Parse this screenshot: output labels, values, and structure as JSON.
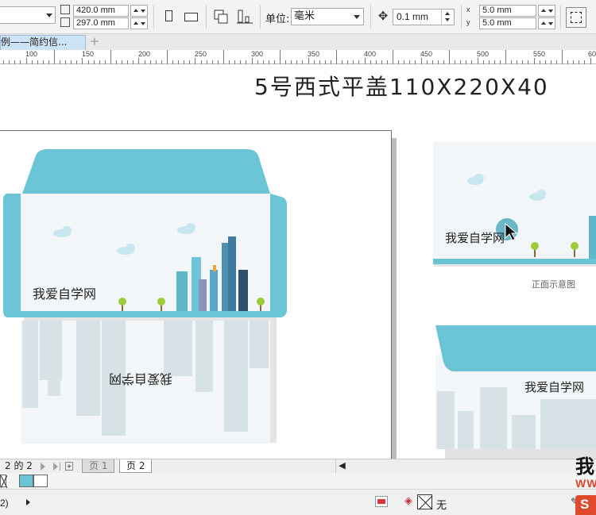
{
  "propbar": {
    "width_value": "420.0 mm",
    "height_value": "297.0 mm",
    "unit_label": "单位:",
    "unit_value": "毫米",
    "nudge_value": "0.1 mm",
    "dup_x_value": "5.0 mm",
    "dup_y_value": "5.0 mm",
    "dup_x_label": "x",
    "dup_y_label": "y"
  },
  "doc_tab": {
    "label": "例——简约信..."
  },
  "ruler": {
    "ticks": [
      "100",
      "150",
      "200",
      "250",
      "300",
      "350",
      "400",
      "450",
      "500",
      "550",
      "60"
    ]
  },
  "canvas": {
    "heading": "5号西式平盖110X220X40",
    "brand_name": "我爱自学网",
    "caption": "正面示意图"
  },
  "pagebar": {
    "page_count": "2 的 2",
    "tabs": [
      "页 1",
      "页 2"
    ]
  },
  "colors": {
    "envelope_blue": "#6cc5d6",
    "envelope_bg": "#f2f6f8",
    "skyline_grey": "#d6e2e5",
    "swatch_cyan": "#6cc5d6"
  },
  "status": {
    "left_text": "2)",
    "fill_none_label": "无"
  },
  "watermark": {
    "big": "我",
    "small": "WW",
    "logo": "S"
  }
}
